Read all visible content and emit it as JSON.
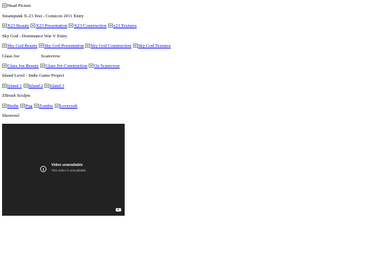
{
  "header_image": {
    "alt": "Head Picture"
  },
  "sections": [
    {
      "title": "Steampunk X-23 Test - Comicon 2011 Entry",
      "links": [
        "X23 Beauty",
        "X23 Presentation",
        "X23 Construction",
        "x23 Textures"
      ]
    },
    {
      "title": "Sky God - Dominance War V Entry",
      "links": [
        "Sky God Beauty",
        "Sky God Presentation",
        "Sky God Construction",
        "Sky God Textures"
      ]
    },
    {
      "title_left": "Glass Joe",
      "title_right": "Scarecrow",
      "links": [
        "Glass Joe Beauty",
        "Glass Joe Construction",
        "Oz Scarecrow"
      ]
    },
    {
      "title": "Island Level - Indie Game Project",
      "links": [
        "Island 1",
        "Island 2",
        "Island 3"
      ]
    },
    {
      "title": "ZBrush Sculpts",
      "links": [
        "Birdie",
        "Pug",
        "Zombie",
        "Lovecraft"
      ]
    },
    {
      "title": "Showreel"
    }
  ],
  "video": {
    "title": "Video unavailable",
    "subtitle": "This video is unavailable",
    "icon": "info-icon",
    "brand_icon": "youtube-icon"
  },
  "colors": {
    "link": "#0000ee",
    "video_bg": "#222222"
  }
}
